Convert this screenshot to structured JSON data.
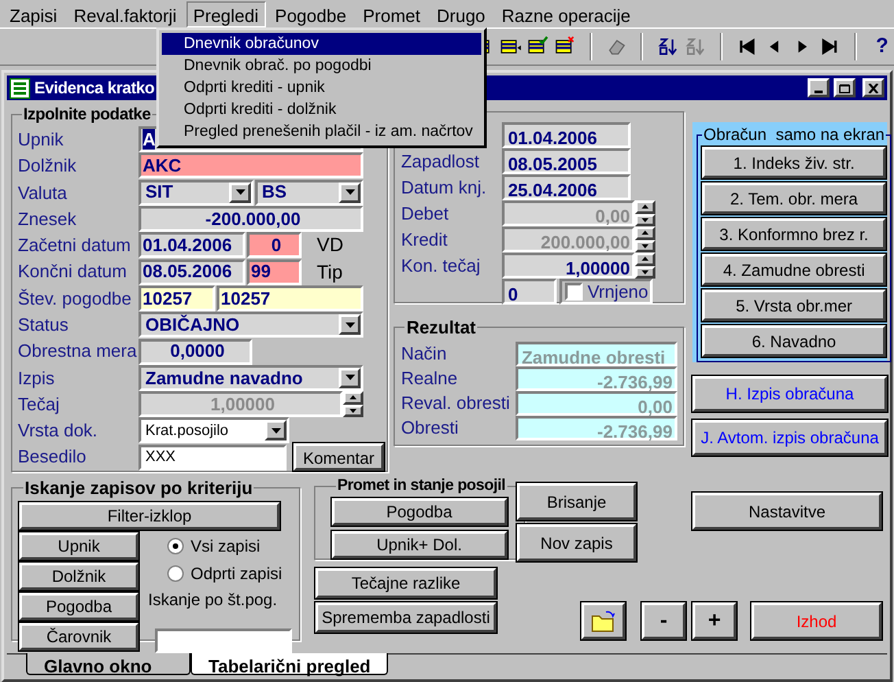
{
  "menu_bar": {
    "items": [
      {
        "label": "Zapisi",
        "selected": false
      },
      {
        "label": "Reval.faktorji",
        "selected": false
      },
      {
        "label": "Pregledi",
        "selected": true
      },
      {
        "label": "Pogodbe",
        "selected": false
      },
      {
        "label": "Promet",
        "selected": false
      },
      {
        "label": "Drugo",
        "selected": false
      },
      {
        "label": "Razne operacije",
        "selected": false
      }
    ]
  },
  "dropdown": {
    "items": [
      {
        "label": "Dnevnik obračunov",
        "selected": true
      },
      {
        "label": "Dnevnik obrač. po pogodbi",
        "selected": false
      },
      {
        "label": "Odprti krediti - upnik",
        "selected": false
      },
      {
        "label": "Odprti krediti - dolžnik",
        "selected": false
      },
      {
        "label": "Pregled prenešenih plačil - iz am. načrtov",
        "selected": false
      }
    ]
  },
  "toolbar": {
    "help": "?"
  },
  "window": {
    "title": "Evidenca kratko"
  },
  "details": {
    "title": "Izpolnite podatke",
    "upnik": {
      "label": "Upnik",
      "fields": [
        {
          "kind": "text",
          "value": "A",
          "highlighted": true
        }
      ]
    },
    "dolznik": {
      "label": "Dolžnik",
      "fields": [
        {
          "kind": "text",
          "value": "AKC",
          "color": "#ff9999"
        }
      ]
    },
    "valuta": {
      "label": "Valuta",
      "fields": [
        {
          "kind": "combo",
          "value": "SIT"
        },
        {
          "kind": "combo",
          "value": "BS"
        }
      ]
    },
    "znesek": {
      "label": "Znesek",
      "fields": [
        {
          "kind": "number",
          "value": "-200.000,00"
        }
      ]
    },
    "zacetni_datum": {
      "label": "Začetni datum",
      "fields": [
        {
          "kind": "text",
          "value": "01.04.2006"
        },
        {
          "kind": "number",
          "value": "0",
          "color": "#ff9999"
        }
      ],
      "note": "VD"
    },
    "koncni_datum": {
      "label": "Končni datum",
      "fields": [
        {
          "kind": "text",
          "value": "08.05.2006"
        },
        {
          "kind": "text",
          "value": "99",
          "color": "#ff9999"
        }
      ],
      "note": "Tip"
    },
    "stev_pogodbe": {
      "label": "Štev. pogodbe",
      "fields": [
        {
          "kind": "text",
          "value": "10257",
          "color": "#ffffcc"
        },
        {
          "kind": "text",
          "value": "10257",
          "color": "#ffffcc"
        }
      ]
    },
    "status": {
      "label": "Status",
      "fields": [
        {
          "kind": "combo",
          "value": "OBIČAJNO"
        }
      ]
    },
    "obrestna_mera": {
      "label": "Obrestna mera",
      "fields": [
        {
          "kind": "number",
          "value": "0,0000"
        }
      ]
    },
    "izpis": {
      "label": "Izpis",
      "fields": [
        {
          "kind": "combo",
          "value": "Zamudne navadno"
        }
      ]
    },
    "tecaj": {
      "label": "Tečaj",
      "fields": [
        {
          "kind": "spin",
          "value": "1,00000",
          "disabled": true
        }
      ]
    },
    "vrsta_dok": {
      "label": "Vrsta dok.",
      "fields": [
        {
          "kind": "plain_combo",
          "value": "Krat.posojilo"
        }
      ]
    },
    "besedilo": {
      "label": "Besedilo",
      "fields": [
        {
          "kind": "plain_text",
          "value": "XXX"
        }
      ],
      "button": "Komentar"
    }
  },
  "dates": {
    "rows": [
      {
        "value": "01.04.2006",
        "kind": "text"
      },
      {
        "label": "Zapadlost",
        "value": "08.05.2005",
        "kind": "text"
      },
      {
        "label": "Datum knj.",
        "value": "25.04.2006",
        "kind": "text"
      },
      {
        "label": "Debet",
        "value": "0,00",
        "kind": "spin",
        "disabled": true
      },
      {
        "label": "Kredit",
        "value": "200.000,00",
        "kind": "spin",
        "disabled": true
      },
      {
        "label": "Kon. tečaj",
        "value": "1,00000",
        "kind": "spin",
        "disabled": false
      }
    ],
    "returned": {
      "value": "0",
      "label": "Vrnjeno",
      "checked": false
    }
  },
  "result": {
    "title": "Rezultat",
    "rows": [
      {
        "label": "Način",
        "value": "Zamudne obresti"
      },
      {
        "label": "Realne",
        "value": "-2.736,99"
      },
      {
        "label": "Reval. obresti",
        "value": "0,00"
      },
      {
        "label": "Obresti",
        "value": "-2.736,99"
      }
    ]
  },
  "calculation": {
    "title": "Obračun  samo na ekran",
    "buttons": [
      "1. Indeks živ. str.",
      "2. Tem. obr. mera",
      "3. Konformno brez r.",
      "4. Zamudne obresti",
      "5. Vrsta obr.mer",
      "6. Navadno"
    ]
  },
  "print_buttons": [
    "H. Izpis obračuna",
    "J. Avtom. izpis obračuna"
  ],
  "search": {
    "title": "Iskanje zapisov po kriteriju",
    "filter": "Filter-izklop",
    "buttons": [
      "Upnik",
      "Dolžnik",
      "Pogodba",
      "Čarovnik"
    ],
    "radios": [
      {
        "label": "Vsi zapisi",
        "selected": true
      },
      {
        "label": "Odprti zapisi",
        "selected": false
      }
    ],
    "contract_label": "Iskanje po št.pog."
  },
  "loans": {
    "title": "Promet in stanje posojil",
    "buttons": [
      "Pogodba",
      "Upnik+ Dol."
    ]
  },
  "rate_buttons": [
    "Tečajne razlike",
    "Sprememba zapadlosti"
  ],
  "record_buttons": [
    "Brisanje",
    "Nov zapis"
  ],
  "settings_button": "Nastavitve",
  "zoom_buttons": [
    "-",
    "+"
  ],
  "exit_button": "Izhod",
  "tabs": [
    {
      "label": "Glavno okno",
      "selected": true
    },
    {
      "label": "Tabelarični pregled",
      "selected": false
    }
  ]
}
